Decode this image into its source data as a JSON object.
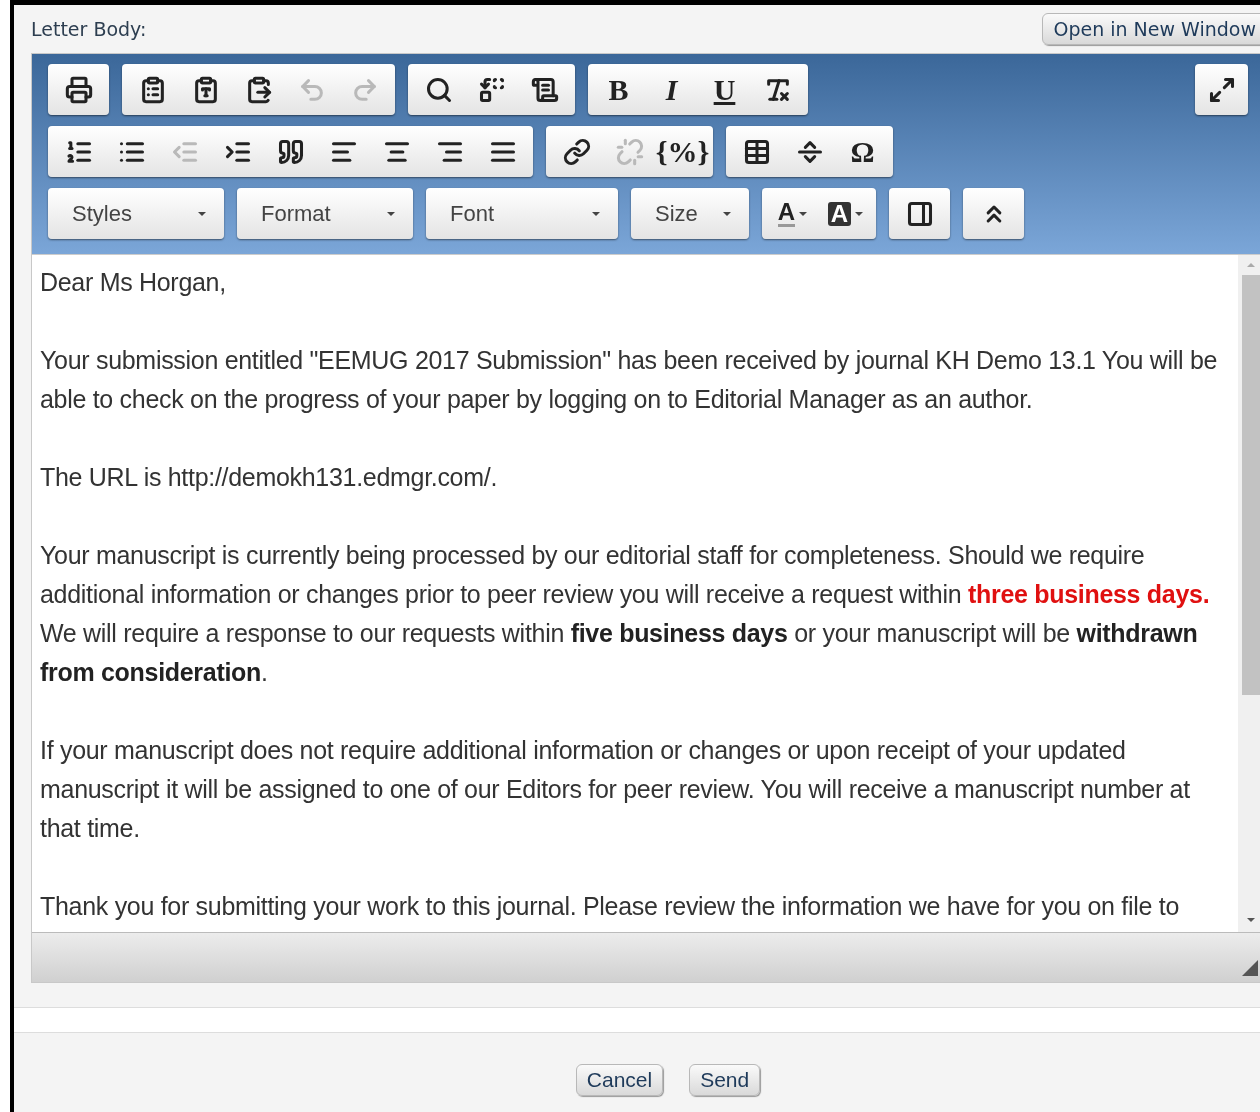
{
  "header": {
    "label": "Letter Body:",
    "open_button": "Open in New Window"
  },
  "toolbar": {
    "rows": [
      {
        "groups": [
          {
            "buttons": [
              {
                "kind": "icon",
                "disabled": false
              }
            ]
          },
          {
            "buttons": [
              {
                "kind": "icon",
                "disabled": false
              },
              {
                "kind": "icon",
                "disabled": false
              },
              {
                "kind": "icon",
                "disabled": false
              },
              {
                "kind": "icon",
                "disabled": true
              },
              {
                "kind": "icon",
                "disabled": true
              }
            ]
          },
          {
            "buttons": [
              {
                "kind": "icon",
                "disabled": false
              },
              {
                "kind": "icon",
                "disabled": false
              },
              {
                "kind": "icon",
                "disabled": false
              }
            ]
          },
          {
            "buttons": [
              {
                "kind": "glyph",
                "glyph": "B",
                "disabled": false
              },
              {
                "kind": "glyph",
                "glyph": "I",
                "disabled": false
              },
              {
                "kind": "glyph",
                "glyph": "U",
                "disabled": false
              },
              {
                "kind": "icon",
                "disabled": false
              }
            ]
          }
        ]
      },
      {
        "groups": [
          {
            "buttons": [
              {
                "kind": "icon",
                "disabled": false
              },
              {
                "kind": "icon",
                "disabled": false
              },
              {
                "kind": "icon",
                "disabled": true
              },
              {
                "kind": "icon",
                "disabled": false
              },
              {
                "kind": "icon",
                "disabled": false
              },
              {
                "kind": "icon",
                "disabled": false
              },
              {
                "kind": "icon",
                "disabled": false
              },
              {
                "kind": "icon",
                "disabled": false
              },
              {
                "kind": "icon",
                "disabled": false
              }
            ]
          },
          {
            "buttons": [
              {
                "kind": "icon",
                "disabled": false
              },
              {
                "kind": "icon",
                "disabled": true
              },
              {
                "kind": "glyph",
                "glyph": "{%}",
                "disabled": false
              }
            ]
          },
          {
            "buttons": [
              {
                "kind": "icon",
                "disabled": false
              },
              {
                "kind": "icon",
                "disabled": false
              },
              {
                "kind": "glyph",
                "glyph": "Ω",
                "disabled": false
              }
            ]
          }
        ]
      },
      {
        "groups": [
          {
            "buttons": [
              {
                "kind": "dropdown",
                "label": "Styles",
                "disabled": false
              }
            ]
          },
          {
            "buttons": [
              {
                "kind": "dropdown",
                "label": "Format",
                "disabled": false
              }
            ]
          },
          {
            "buttons": [
              {
                "kind": "dropdown",
                "label": "Font",
                "disabled": false
              }
            ]
          },
          {
            "buttons": [
              {
                "kind": "dropdown",
                "label": "Size",
                "disabled": false
              }
            ]
          },
          {
            "buttons": [
              {
                "kind": "text-color",
                "glyph": "A",
                "disabled": false
              },
              {
                "kind": "back-color",
                "glyph": "A",
                "disabled": false
              }
            ]
          },
          {
            "buttons": [
              {
                "kind": "icon",
                "disabled": false
              }
            ]
          },
          {
            "buttons": [
              {
                "kind": "icon",
                "disabled": false
              }
            ]
          }
        ]
      }
    ]
  },
  "body": {
    "paragraphs": [
      [
        {
          "kind": "plain",
          "text": "Dear Ms Horgan,"
        }
      ],
      [
        {
          "kind": "plain",
          "text": "Your submission entitled \"EEMUG 2017 Submission\" has been received by journal KH Demo 13.1 You will be able to check on the progress of your paper by logging on to Editorial Manager as an author."
        }
      ],
      [
        {
          "kind": "plain",
          "text": "The URL is http://demokh131.edmgr.com/."
        }
      ],
      [
        {
          "kind": "plain",
          "text": "Your manuscript is currently being processed by our editorial staff for completeness. Should we require additional information or changes prior to peer review you will receive a request within "
        },
        {
          "kind": "red",
          "text": "three business days."
        },
        {
          "kind": "plain",
          "text": " We will require a response to our requests within "
        },
        {
          "kind": "bold",
          "text": "five business days"
        },
        {
          "kind": "plain",
          "text": " or your manuscript will be "
        },
        {
          "kind": "bold",
          "text": "withdrawn from consideration"
        },
        {
          "kind": "plain",
          "text": "."
        }
      ],
      [
        {
          "kind": "plain",
          "text": "If your manuscript does not require additional information or changes or upon receipt of your updated manuscript it will be assigned to one of our Editors for peer review. You will receive a manuscript number at that time."
        }
      ],
      [
        {
          "kind": "plain",
          "text": "Thank you for submitting your work to this journal. Please review the information we have for you on file to"
        }
      ]
    ]
  },
  "footer": {
    "buttons": [
      "Cancel",
      "Send"
    ]
  }
}
